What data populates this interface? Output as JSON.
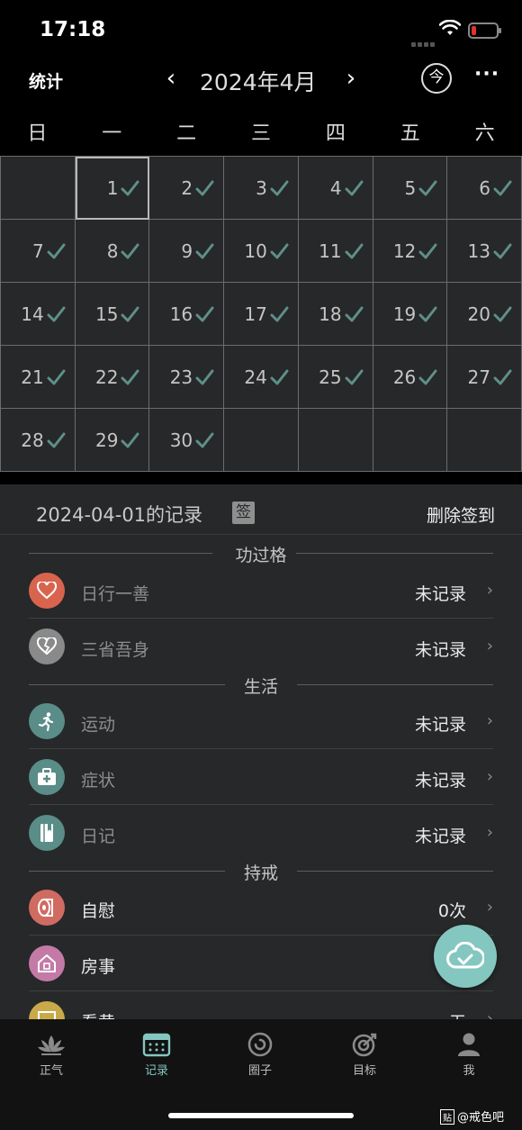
{
  "status_bar": {
    "time": "17:18"
  },
  "header": {
    "stats_label": "统计",
    "prev_label": "‹",
    "month_title": "2024年4月",
    "next_label": "›",
    "today_label": "今",
    "more_label": "···"
  },
  "weekdays": [
    "日",
    "一",
    "二",
    "三",
    "四",
    "五",
    "六"
  ],
  "calendar": {
    "leading_blank_days": 1,
    "selected_day": 1,
    "days": [
      {
        "day": "1",
        "checked": true
      },
      {
        "day": "2",
        "checked": true
      },
      {
        "day": "3",
        "checked": true
      },
      {
        "day": "4",
        "checked": true
      },
      {
        "day": "5",
        "checked": true
      },
      {
        "day": "6",
        "checked": true
      },
      {
        "day": "7",
        "checked": true
      },
      {
        "day": "8",
        "checked": true
      },
      {
        "day": "9",
        "checked": true
      },
      {
        "day": "10",
        "checked": true
      },
      {
        "day": "11",
        "checked": true
      },
      {
        "day": "12",
        "checked": true
      },
      {
        "day": "13",
        "checked": true
      },
      {
        "day": "14",
        "checked": true
      },
      {
        "day": "15",
        "checked": true
      },
      {
        "day": "16",
        "checked": true
      },
      {
        "day": "17",
        "checked": true
      },
      {
        "day": "18",
        "checked": true
      },
      {
        "day": "19",
        "checked": true
      },
      {
        "day": "20",
        "checked": true
      },
      {
        "day": "21",
        "checked": true
      },
      {
        "day": "22",
        "checked": true
      },
      {
        "day": "23",
        "checked": true
      },
      {
        "day": "24",
        "checked": true
      },
      {
        "day": "25",
        "checked": true
      },
      {
        "day": "26",
        "checked": true
      },
      {
        "day": "27",
        "checked": true
      },
      {
        "day": "28",
        "checked": true
      },
      {
        "day": "29",
        "checked": true
      },
      {
        "day": "30",
        "checked": true
      }
    ],
    "check_color": "#5f8f89"
  },
  "record_panel": {
    "date_title": "2024-04-01的记录",
    "sign_badge": "签",
    "delete_label": "删除签到",
    "sections": {
      "merit": "功过格",
      "life": "生活",
      "abstain": "持戒"
    },
    "rows": {
      "good_deed": {
        "label": "日行一善",
        "value": "未记录",
        "icon": "heart-icon",
        "color": "#d9644e"
      },
      "reflect": {
        "label": "三省吾身",
        "value": "未记录",
        "icon": "broken-heart-icon",
        "color": "#8a8a8a"
      },
      "exercise": {
        "label": "运动",
        "value": "未记录",
        "icon": "running-icon",
        "color": "#5a8c88"
      },
      "symptoms": {
        "label": "症状",
        "value": "未记录",
        "icon": "medical-kit-icon",
        "color": "#5a8c88"
      },
      "diary": {
        "label": "日记",
        "value": "未记录",
        "icon": "notebook-icon",
        "color": "#5a8c88"
      },
      "self_comfort": {
        "label": "自慰",
        "value": "0次",
        "icon": "tissue-roll-icon",
        "color": "#d06b62"
      },
      "intimacy": {
        "label": "房事",
        "value": "",
        "icon": "house-icon",
        "color": "#c47aa6"
      },
      "watch": {
        "label": "看黄",
        "value": "无",
        "icon": "picture-icon",
        "color": "#c9a94a"
      }
    }
  },
  "tabs": [
    {
      "label": "正气",
      "icon": "lotus-icon",
      "active": false
    },
    {
      "label": "记录",
      "icon": "calendar-icon",
      "active": true
    },
    {
      "label": "圈子",
      "icon": "circle-icon",
      "active": false
    },
    {
      "label": "目标",
      "icon": "target-icon",
      "active": false
    },
    {
      "label": "我",
      "icon": "user-icon",
      "active": false
    }
  ],
  "watermark": {
    "box_text": "贴",
    "text": "@戒色吧"
  },
  "colors": {
    "accent": "#84c7c0",
    "panel_bg": "#262829",
    "background": "#000000"
  }
}
